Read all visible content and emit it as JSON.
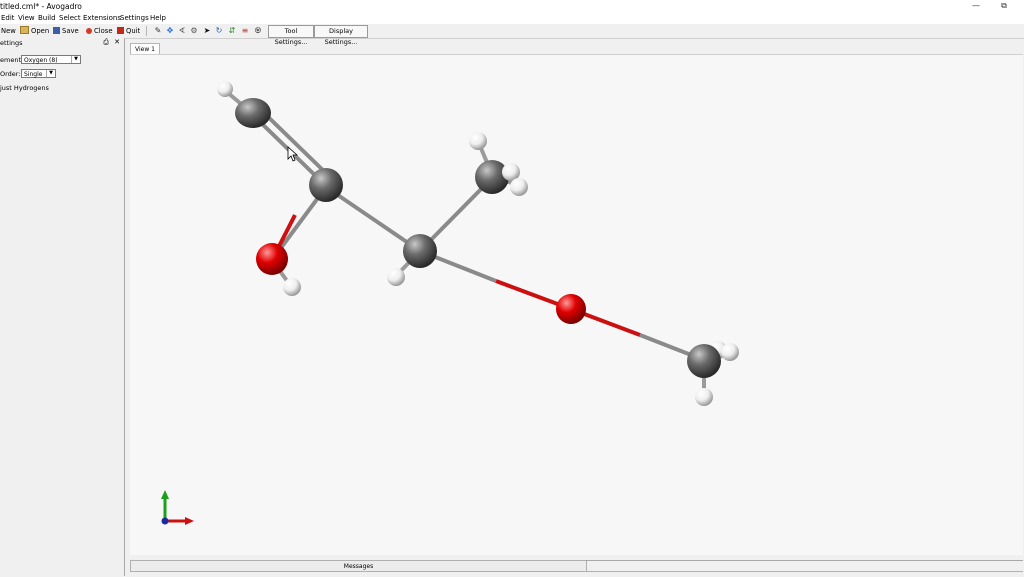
{
  "window": {
    "title": "titled.cml* - Avogadro"
  },
  "menu": [
    "Edit",
    "View",
    "Build",
    "Select",
    "Extensions",
    "Settings",
    "Help"
  ],
  "toolbar": {
    "new_label": "New",
    "open_label": "Open",
    "save_label": "Save",
    "close_label": "Close",
    "quit_label": "Quit",
    "tool_settings_label": "Tool Settings...",
    "display_settings_label": "Display Settings..."
  },
  "dock": {
    "title": "ettings",
    "element_label": "ement:",
    "element_value": "Oxygen (8)",
    "order_label": "Order:",
    "order_value": "Single",
    "adjust_label": "just Hydrogens"
  },
  "view_tab": "View 1",
  "messages_tab": "Messages",
  "colors": {
    "carbon": "#5a5a5a",
    "oxygen": "#dd0000",
    "hydrogen": "#f2f2f2",
    "bond": "#8a8a8a"
  }
}
